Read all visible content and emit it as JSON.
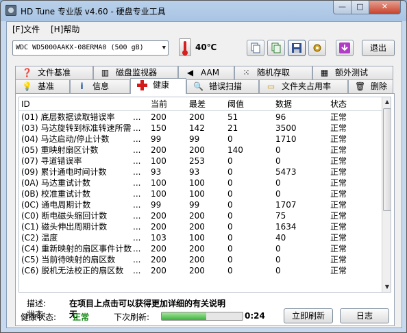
{
  "window": {
    "title": "HD Tune 专业版 v4.60 - 硬盘专业工具",
    "minimize": "—",
    "maximize": "□",
    "close": "✕"
  },
  "menu": [
    {
      "label": "[F]文件"
    },
    {
      "label": "[H]帮助"
    }
  ],
  "toolbar": {
    "drive": "WDC WD5000AAKX-08ERMA0 (500 gB)",
    "temperature": "40℃",
    "exit_label": "退出",
    "icons": [
      "copy-icon",
      "copy-info-icon",
      "save-icon",
      "settings-icon",
      "download-icon"
    ]
  },
  "tabs_row1": [
    {
      "label": "文件基准",
      "icon": "file-benchmark-icon"
    },
    {
      "label": "磁盘监视器",
      "icon": "disk-monitor-icon"
    },
    {
      "label": "AAM",
      "icon": "speaker-icon"
    },
    {
      "label": "随机存取",
      "icon": "random-access-icon"
    },
    {
      "label": "额外测试",
      "icon": "extra-tests-icon"
    }
  ],
  "tabs_row2": [
    {
      "label": "基准",
      "icon": "lightbulb-icon"
    },
    {
      "label": "信息",
      "icon": "info-icon"
    },
    {
      "label": "健康",
      "icon": "health-cross-icon",
      "active": true
    },
    {
      "label": "错误扫描",
      "icon": "magnifier-icon"
    },
    {
      "label": "文件夹占用率",
      "icon": "folder-icon"
    },
    {
      "label": "删除",
      "icon": "trash-icon"
    }
  ],
  "grid": {
    "headers": {
      "id": "ID",
      "current": "当前",
      "worst": "最差",
      "threshold": "阈值",
      "data": "数据",
      "status": "状态"
    },
    "rows": [
      {
        "id": "(01) 底层数据读取错误率",
        "current": "200",
        "worst": "200",
        "threshold": "51",
        "data": "96",
        "status": "正常"
      },
      {
        "id": "(03) 马达旋转到标准转速所需",
        "current": "150",
        "worst": "142",
        "threshold": "21",
        "data": "3500",
        "status": "正常"
      },
      {
        "id": "(04) 马达启动/停止计数",
        "current": "99",
        "worst": "99",
        "threshold": "0",
        "data": "1710",
        "status": "正常"
      },
      {
        "id": "(05) 重映射扇区计数",
        "current": "200",
        "worst": "200",
        "threshold": "140",
        "data": "0",
        "status": "正常"
      },
      {
        "id": "(07) 寻道错误率",
        "current": "100",
        "worst": "253",
        "threshold": "0",
        "data": "0",
        "status": "正常"
      },
      {
        "id": "(09) 累计通电时间计数",
        "current": "93",
        "worst": "93",
        "threshold": "0",
        "data": "5473",
        "status": "正常"
      },
      {
        "id": "(0A) 马达重试计数",
        "current": "100",
        "worst": "100",
        "threshold": "0",
        "data": "0",
        "status": "正常"
      },
      {
        "id": "(0B) 校准重试计数",
        "current": "100",
        "worst": "100",
        "threshold": "0",
        "data": "0",
        "status": "正常"
      },
      {
        "id": "(0C) 通电周期计数",
        "current": "99",
        "worst": "99",
        "threshold": "0",
        "data": "1707",
        "status": "正常"
      },
      {
        "id": "(C0) 断电磁头缩回计数",
        "current": "200",
        "worst": "200",
        "threshold": "0",
        "data": "75",
        "status": "正常"
      },
      {
        "id": "(C1) 磁头伸出周期计数",
        "current": "200",
        "worst": "200",
        "threshold": "0",
        "data": "1634",
        "status": "正常"
      },
      {
        "id": "(C2) 温度",
        "current": "103",
        "worst": "100",
        "threshold": "0",
        "data": "40",
        "status": "正常"
      },
      {
        "id": "(C4) 重新映射的扇区事件计数",
        "current": "200",
        "worst": "200",
        "threshold": "0",
        "data": "0",
        "status": "正常"
      },
      {
        "id": "(C5) 当前待映射的扇区数",
        "current": "200",
        "worst": "200",
        "threshold": "0",
        "data": "0",
        "status": "正常"
      },
      {
        "id": "(C6) 脱机无法校正的扇区数",
        "current": "200",
        "worst": "200",
        "threshold": "0",
        "data": "0",
        "status": "正常"
      }
    ]
  },
  "description": {
    "desc_label": "描述:",
    "desc_value": "在项目上点击可以获得更加详细的有关说明",
    "state_label": "状态:",
    "state_value": "无"
  },
  "footer": {
    "health_label": "健康状态:",
    "health_value": "正常",
    "next_refresh_label": "下次刷新:",
    "progress": 0.55,
    "timer": "0:24",
    "refresh_button": "立即刷新",
    "log_button": "日志"
  },
  "colors": {
    "health_ok": "#1a8a1a",
    "health_tab_icon": "#d21a1a",
    "progress_fill": "#3cb33c"
  }
}
